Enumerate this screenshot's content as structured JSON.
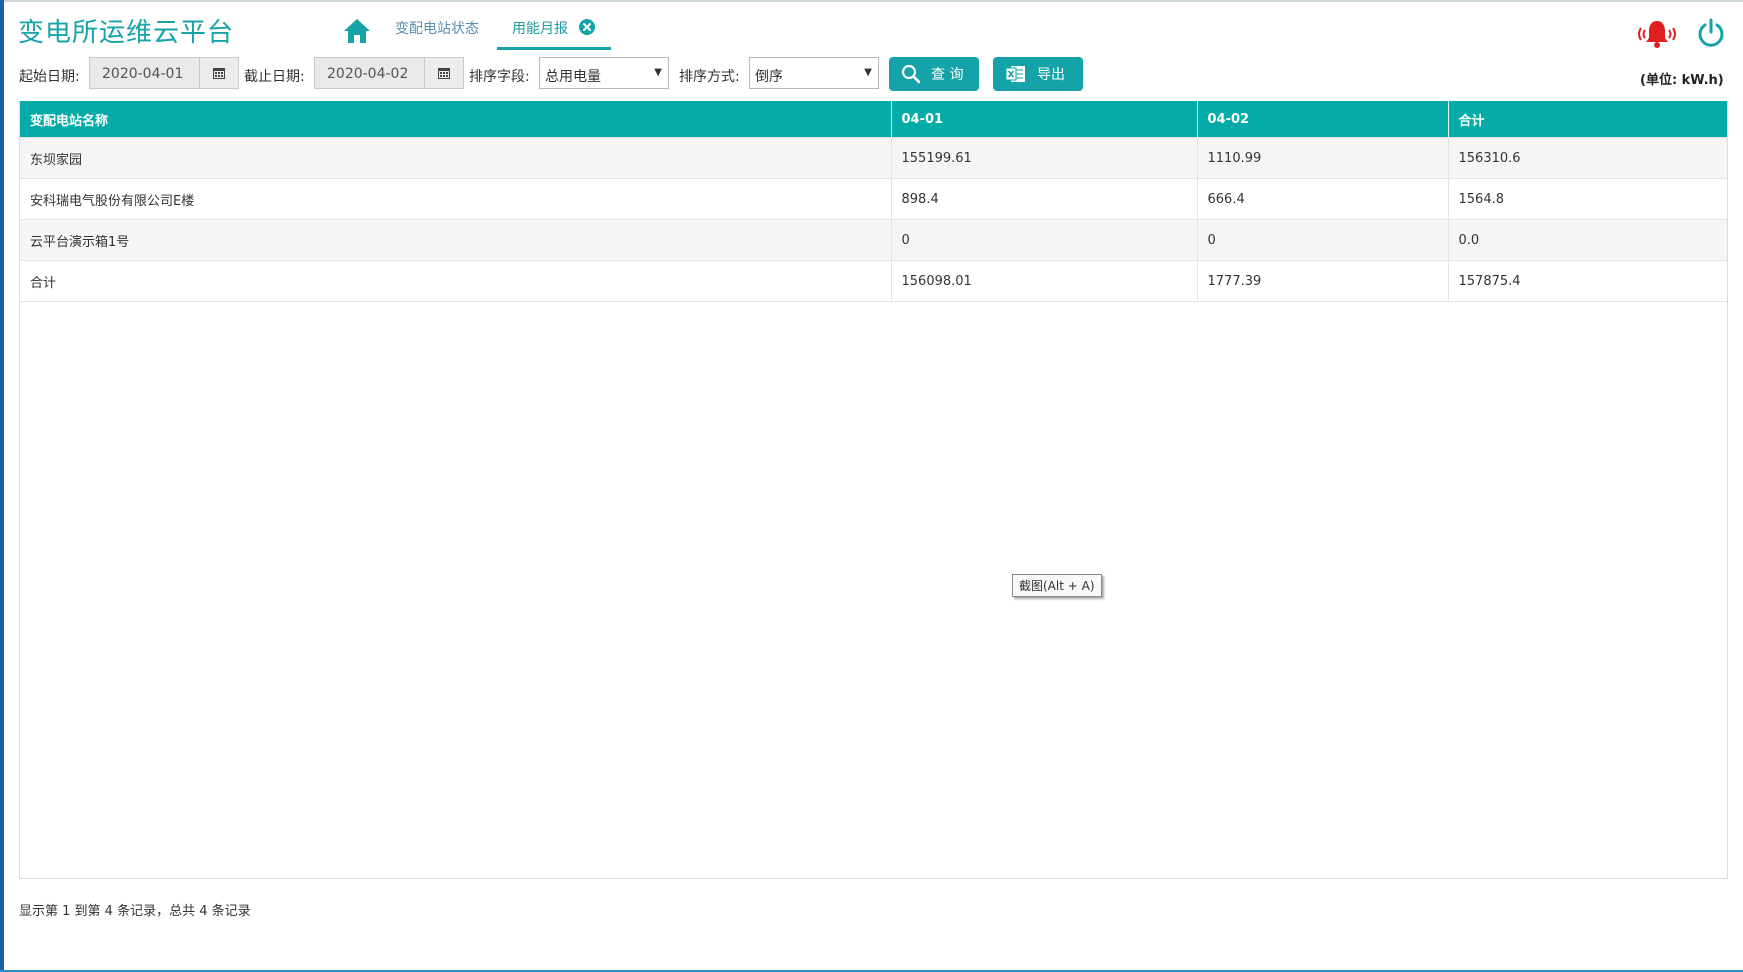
{
  "app": {
    "title": "变电所运维云平台"
  },
  "nav": {
    "tabs": [
      {
        "label": "变配电站状态"
      },
      {
        "label": "用能月报"
      }
    ]
  },
  "filters": {
    "start_label": "起始日期:",
    "start_value": "2020-04-01",
    "end_label": "截止日期:",
    "end_value": "2020-04-02",
    "sort_field_label": "排序字段:",
    "sort_field_value": "总用电量",
    "sort_order_label": "排序方式:",
    "sort_order_value": "倒序",
    "query_label": "查 询",
    "export_label": "导出",
    "unit": "(单位: kW.h)"
  },
  "table": {
    "headers": [
      "变配电站名称",
      "04-01",
      "04-02",
      "合计"
    ],
    "rows": [
      [
        "东坝家园",
        "155199.61",
        "1110.99",
        "156310.6"
      ],
      [
        "安科瑞电气股份有限公司E楼",
        "898.4",
        "666.4",
        "1564.8"
      ],
      [
        "云平台演示箱1号",
        "0",
        "0",
        "0.0"
      ],
      [
        "合计",
        "156098.01",
        "1777.39",
        "157875.4"
      ]
    ]
  },
  "tooltip": "截图(Alt + A)",
  "footer": "显示第 1 到第 4 条记录，总共 4 条记录",
  "colors": {
    "accent": "#14a3a8",
    "alarm": "#e02020"
  }
}
